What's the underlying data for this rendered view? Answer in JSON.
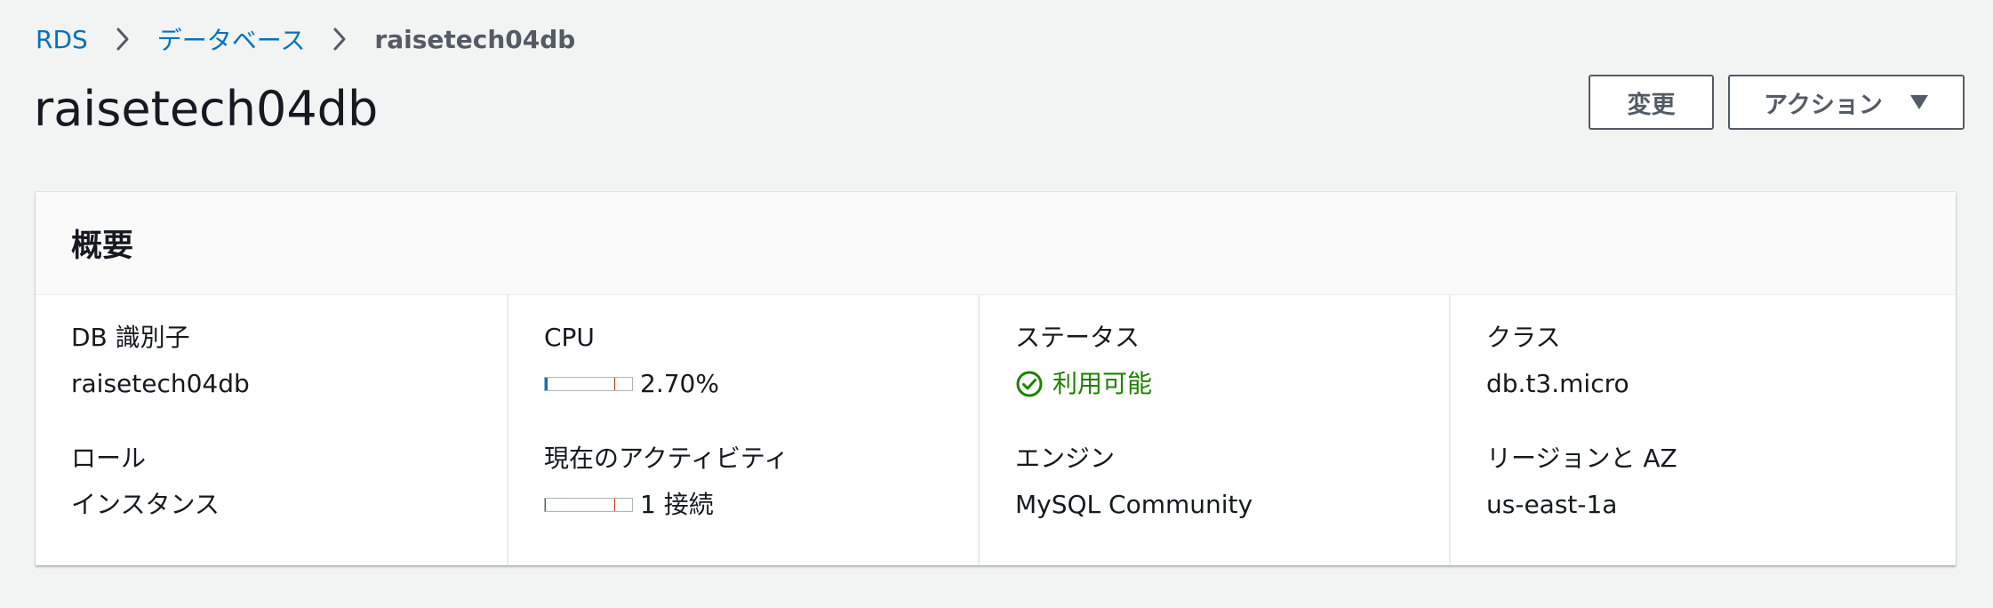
{
  "breadcrumb": {
    "items": [
      "RDS",
      "データベース"
    ],
    "current": "raisetech04db"
  },
  "page": {
    "title": "raisetech04db"
  },
  "actions": {
    "modify_label": "変更",
    "actions_label": "アクション"
  },
  "summary": {
    "title": "概要",
    "db_identifier_label": "DB 識別子",
    "db_identifier_value": "raisetech04db",
    "role_label": "ロール",
    "role_value": "インスタンス",
    "cpu_label": "CPU",
    "cpu_value": "2.70%",
    "cpu_fraction": 0.027,
    "activity_label": "現在のアクティビティ",
    "activity_value": "1 接続",
    "activity_fraction": 0.01,
    "status_label": "ステータス",
    "status_value": "利用可能",
    "engine_label": "エンジン",
    "engine_value": "MySQL Community",
    "class_label": "クラス",
    "class_value": "db.t3.micro",
    "region_label": "リージョンと AZ",
    "region_value": "us-east-1a"
  },
  "colors": {
    "link": "#0073bb",
    "status_ok": "#1d8102",
    "meter_fill": "#0073bb",
    "meter_threshold": "#d13212"
  },
  "icons": [
    "chevron-right-icon",
    "caret-down-icon",
    "status-check-icon"
  ]
}
